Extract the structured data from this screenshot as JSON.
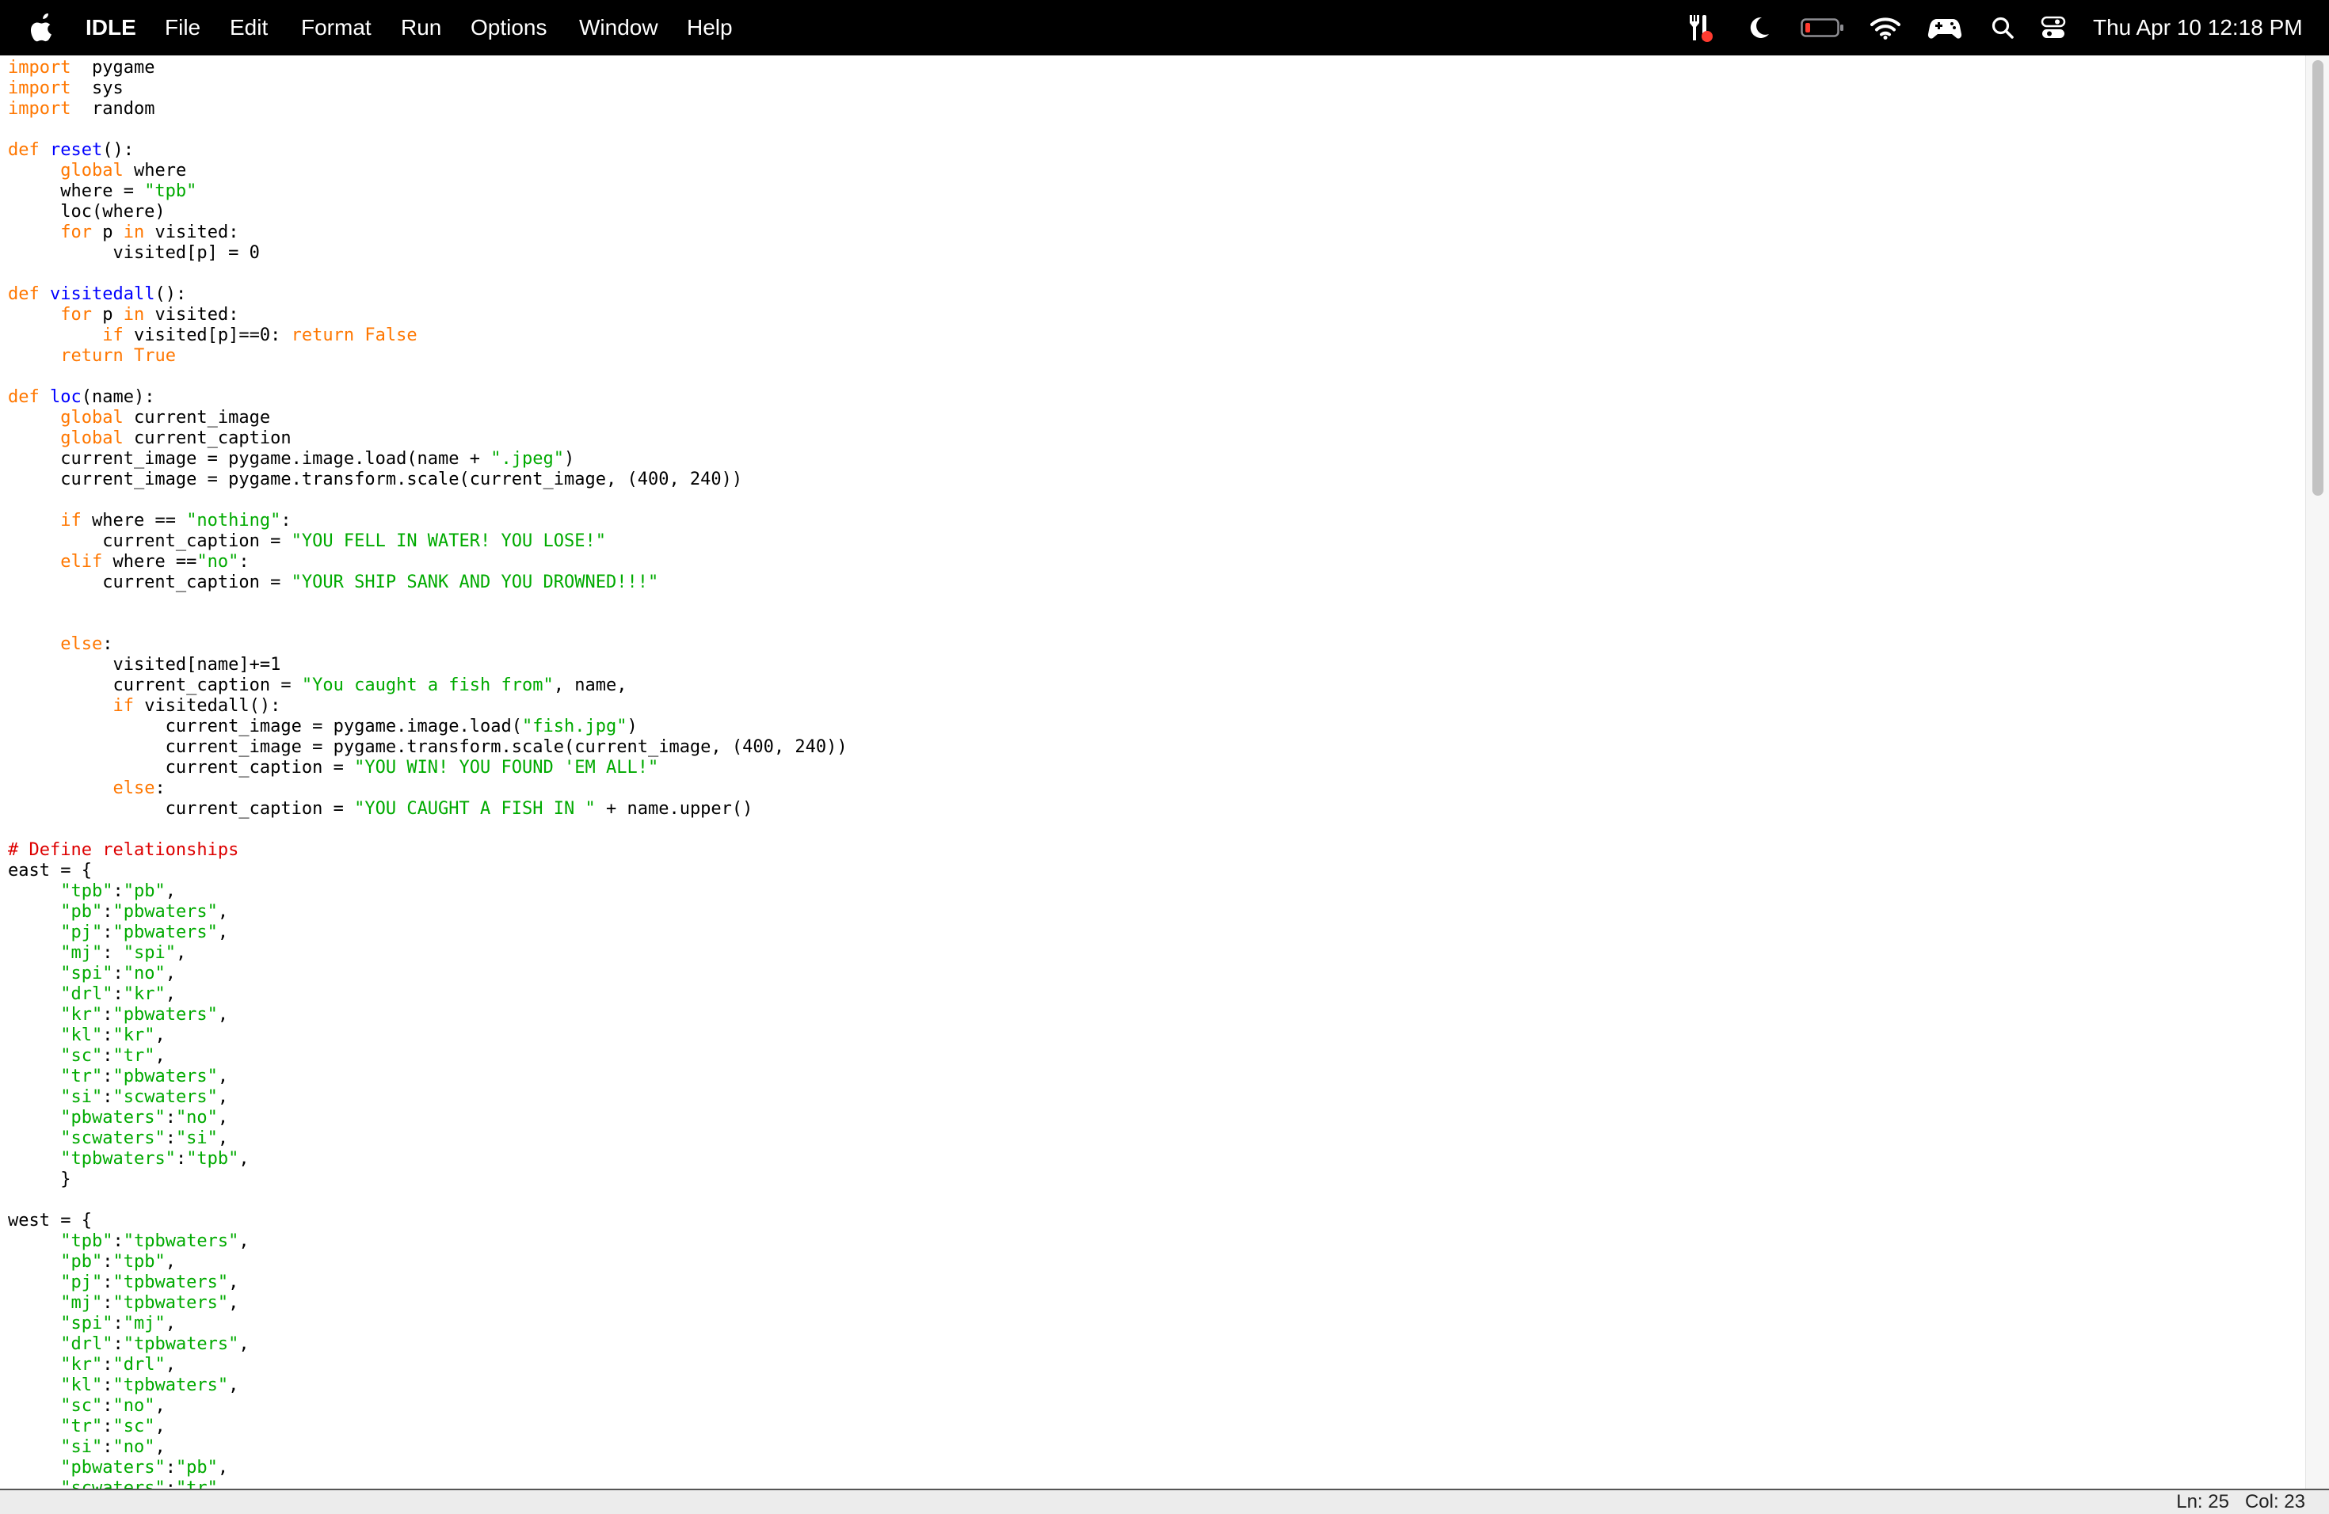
{
  "menubar": {
    "app_name": "IDLE",
    "items": [
      "File",
      "Edit",
      "Format",
      "Run",
      "Options",
      "Window",
      "Help"
    ],
    "status_icons": [
      "apple-icon",
      "app-status-icon",
      "focus-moon-icon",
      "battery-icon",
      "wifi-icon",
      "game-controller-icon",
      "search-icon",
      "control-center-icon"
    ],
    "datetime": "Thu Apr 10  12:18 PM"
  },
  "colors": {
    "keyword": "#ff7700",
    "builtin": "#900090",
    "definition": "#0000ff",
    "string": "#00aa00",
    "comment": "#dd0000",
    "battery_low": "#ff3b30"
  },
  "editor": {
    "lines": [
      [
        [
          "kw",
          "import"
        ],
        [
          "",
          "  pygame"
        ]
      ],
      [
        [
          "kw",
          "import"
        ],
        [
          "",
          "  sys"
        ]
      ],
      [
        [
          "kw",
          "import"
        ],
        [
          "",
          "  random"
        ]
      ],
      [],
      [
        [
          "kw",
          "def"
        ],
        [
          "",
          " "
        ],
        [
          "fn",
          "reset"
        ],
        [
          "",
          "():"
        ]
      ],
      [
        [
          "",
          "     "
        ],
        [
          "kw",
          "global"
        ],
        [
          "",
          " where"
        ]
      ],
      [
        [
          "",
          "     where = "
        ],
        [
          "str",
          "\"tpb\""
        ]
      ],
      [
        [
          "",
          "     loc(where)"
        ]
      ],
      [
        [
          "",
          "     "
        ],
        [
          "kw",
          "for"
        ],
        [
          "",
          " p "
        ],
        [
          "kw",
          "in"
        ],
        [
          "",
          " visited:"
        ]
      ],
      [
        [
          "",
          "          visited[p] = 0"
        ]
      ],
      [],
      [
        [
          "kw",
          "def"
        ],
        [
          "",
          " "
        ],
        [
          "fn",
          "visitedall"
        ],
        [
          "",
          "():"
        ]
      ],
      [
        [
          "",
          "     "
        ],
        [
          "kw",
          "for"
        ],
        [
          "",
          " p "
        ],
        [
          "kw",
          "in"
        ],
        [
          "",
          " visited:"
        ]
      ],
      [
        [
          "",
          "         "
        ],
        [
          "kw",
          "if"
        ],
        [
          "",
          " visited[p]==0: "
        ],
        [
          "kw",
          "return"
        ],
        [
          "",
          " "
        ],
        [
          "kw",
          "False"
        ]
      ],
      [
        [
          "",
          "     "
        ],
        [
          "kw",
          "return"
        ],
        [
          "",
          " "
        ],
        [
          "kw",
          "True"
        ]
      ],
      [],
      [
        [
          "kw",
          "def"
        ],
        [
          "",
          " "
        ],
        [
          "fn",
          "loc"
        ],
        [
          "",
          "(name):"
        ]
      ],
      [
        [
          "",
          "     "
        ],
        [
          "kw",
          "global"
        ],
        [
          "",
          " current_image"
        ]
      ],
      [
        [
          "",
          "     "
        ],
        [
          "kw",
          "global"
        ],
        [
          "",
          " current_caption"
        ]
      ],
      [
        [
          "",
          "     current_image = pygame.image.load(name + "
        ],
        [
          "str",
          "\".jpeg\""
        ],
        [
          "",
          ")"
        ]
      ],
      [
        [
          "",
          "     current_image = pygame.transform.scale(current_image, (400, 240))"
        ]
      ],
      [],
      [
        [
          "",
          "     "
        ],
        [
          "kw",
          "if"
        ],
        [
          "",
          " where == "
        ],
        [
          "str",
          "\"nothing\""
        ],
        [
          "",
          ":"
        ]
      ],
      [
        [
          "",
          "         current_caption = "
        ],
        [
          "str",
          "\"YOU FELL IN WATER! YOU LOSE!\""
        ]
      ],
      [
        [
          "",
          "     "
        ],
        [
          "kw",
          "elif"
        ],
        [
          "",
          " where =="
        ],
        [
          "str",
          "\"no\""
        ],
        [
          "",
          ":"
        ]
      ],
      [
        [
          "",
          "         current_caption = "
        ],
        [
          "str",
          "\"YOUR SHIP SANK AND YOU DROWNED!!!\""
        ]
      ],
      [],
      [],
      [
        [
          "",
          "     "
        ],
        [
          "kw",
          "else"
        ],
        [
          "",
          ":"
        ]
      ],
      [
        [
          "",
          "          visited[name]+=1"
        ]
      ],
      [
        [
          "",
          "          current_caption = "
        ],
        [
          "str",
          "\"You caught a fish from\""
        ],
        [
          "",
          ", name,"
        ]
      ],
      [
        [
          "",
          "          "
        ],
        [
          "kw",
          "if"
        ],
        [
          "",
          " visitedall():"
        ]
      ],
      [
        [
          "",
          "               current_image = pygame.image.load("
        ],
        [
          "str",
          "\"fish.jpg\""
        ],
        [
          "",
          ")"
        ]
      ],
      [
        [
          "",
          "               current_image = pygame.transform.scale(current_image, (400, 240))"
        ]
      ],
      [
        [
          "",
          "               current_caption = "
        ],
        [
          "str",
          "\"YOU WIN! YOU FOUND 'EM ALL!\""
        ]
      ],
      [
        [
          "",
          "          "
        ],
        [
          "kw",
          "else"
        ],
        [
          "",
          ":"
        ]
      ],
      [
        [
          "",
          "               current_caption = "
        ],
        [
          "str",
          "\"YOU CAUGHT A FISH IN \""
        ],
        [
          "",
          " + name.upper()"
        ]
      ],
      [],
      [
        [
          "cm",
          "# Define relationships"
        ]
      ],
      [
        [
          "",
          "east = {"
        ]
      ],
      [
        [
          "",
          "     "
        ],
        [
          "str",
          "\"tpb\""
        ],
        [
          "",
          ":"
        ],
        [
          "str",
          "\"pb\""
        ],
        [
          "",
          ","
        ]
      ],
      [
        [
          "",
          "     "
        ],
        [
          "str",
          "\"pb\""
        ],
        [
          "",
          ":"
        ],
        [
          "str",
          "\"pbwaters\""
        ],
        [
          "",
          ","
        ]
      ],
      [
        [
          "",
          "     "
        ],
        [
          "str",
          "\"pj\""
        ],
        [
          "",
          ":"
        ],
        [
          "str",
          "\"pbwaters\""
        ],
        [
          "",
          ","
        ]
      ],
      [
        [
          "",
          "     "
        ],
        [
          "str",
          "\"mj\""
        ],
        [
          "",
          ": "
        ],
        [
          "str",
          "\"spi\""
        ],
        [
          "",
          ","
        ]
      ],
      [
        [
          "",
          "     "
        ],
        [
          "str",
          "\"spi\""
        ],
        [
          "",
          ":"
        ],
        [
          "str",
          "\"no\""
        ],
        [
          "",
          ","
        ]
      ],
      [
        [
          "",
          "     "
        ],
        [
          "str",
          "\"drl\""
        ],
        [
          "",
          ":"
        ],
        [
          "str",
          "\"kr\""
        ],
        [
          "",
          ","
        ]
      ],
      [
        [
          "",
          "     "
        ],
        [
          "str",
          "\"kr\""
        ],
        [
          "",
          ":"
        ],
        [
          "str",
          "\"pbwaters\""
        ],
        [
          "",
          ","
        ]
      ],
      [
        [
          "",
          "     "
        ],
        [
          "str",
          "\"kl\""
        ],
        [
          "",
          ":"
        ],
        [
          "str",
          "\"kr\""
        ],
        [
          "",
          ","
        ]
      ],
      [
        [
          "",
          "     "
        ],
        [
          "str",
          "\"sc\""
        ],
        [
          "",
          ":"
        ],
        [
          "str",
          "\"tr\""
        ],
        [
          "",
          ","
        ]
      ],
      [
        [
          "",
          "     "
        ],
        [
          "str",
          "\"tr\""
        ],
        [
          "",
          ":"
        ],
        [
          "str",
          "\"pbwaters\""
        ],
        [
          "",
          ","
        ]
      ],
      [
        [
          "",
          "     "
        ],
        [
          "str",
          "\"si\""
        ],
        [
          "",
          ":"
        ],
        [
          "str",
          "\"scwaters\""
        ],
        [
          "",
          ","
        ]
      ],
      [
        [
          "",
          "     "
        ],
        [
          "str",
          "\"pbwaters\""
        ],
        [
          "",
          ":"
        ],
        [
          "str",
          "\"no\""
        ],
        [
          "",
          ","
        ]
      ],
      [
        [
          "",
          "     "
        ],
        [
          "str",
          "\"scwaters\""
        ],
        [
          "",
          ":"
        ],
        [
          "str",
          "\"si\""
        ],
        [
          "",
          ","
        ]
      ],
      [
        [
          "",
          "     "
        ],
        [
          "str",
          "\"tpbwaters\""
        ],
        [
          "",
          ":"
        ],
        [
          "str",
          "\"tpb\""
        ],
        [
          "",
          ","
        ]
      ],
      [
        [
          "",
          "     }"
        ]
      ],
      [],
      [
        [
          "",
          "west = {"
        ]
      ],
      [
        [
          "",
          "     "
        ],
        [
          "str",
          "\"tpb\""
        ],
        [
          "",
          ":"
        ],
        [
          "str",
          "\"tpbwaters\""
        ],
        [
          "",
          ","
        ]
      ],
      [
        [
          "",
          "     "
        ],
        [
          "str",
          "\"pb\""
        ],
        [
          "",
          ":"
        ],
        [
          "str",
          "\"tpb\""
        ],
        [
          "",
          ","
        ]
      ],
      [
        [
          "",
          "     "
        ],
        [
          "str",
          "\"pj\""
        ],
        [
          "",
          ":"
        ],
        [
          "str",
          "\"tpbwaters\""
        ],
        [
          "",
          ","
        ]
      ],
      [
        [
          "",
          "     "
        ],
        [
          "str",
          "\"mj\""
        ],
        [
          "",
          ":"
        ],
        [
          "str",
          "\"tpbwaters\""
        ],
        [
          "",
          ","
        ]
      ],
      [
        [
          "",
          "     "
        ],
        [
          "str",
          "\"spi\""
        ],
        [
          "",
          ":"
        ],
        [
          "str",
          "\"mj\""
        ],
        [
          "",
          ","
        ]
      ],
      [
        [
          "",
          "     "
        ],
        [
          "str",
          "\"drl\""
        ],
        [
          "",
          ":"
        ],
        [
          "str",
          "\"tpbwaters\""
        ],
        [
          "",
          ","
        ]
      ],
      [
        [
          "",
          "     "
        ],
        [
          "str",
          "\"kr\""
        ],
        [
          "",
          ":"
        ],
        [
          "str",
          "\"drl\""
        ],
        [
          "",
          ","
        ]
      ],
      [
        [
          "",
          "     "
        ],
        [
          "str",
          "\"kl\""
        ],
        [
          "",
          ":"
        ],
        [
          "str",
          "\"tpbwaters\""
        ],
        [
          "",
          ","
        ]
      ],
      [
        [
          "",
          "     "
        ],
        [
          "str",
          "\"sc\""
        ],
        [
          "",
          ":"
        ],
        [
          "str",
          "\"no\""
        ],
        [
          "",
          ","
        ]
      ],
      [
        [
          "",
          "     "
        ],
        [
          "str",
          "\"tr\""
        ],
        [
          "",
          ":"
        ],
        [
          "str",
          "\"sc\""
        ],
        [
          "",
          ","
        ]
      ],
      [
        [
          "",
          "     "
        ],
        [
          "str",
          "\"si\""
        ],
        [
          "",
          ":"
        ],
        [
          "str",
          "\"no\""
        ],
        [
          "",
          ","
        ]
      ],
      [
        [
          "",
          "     "
        ],
        [
          "str",
          "\"pbwaters\""
        ],
        [
          "",
          ":"
        ],
        [
          "str",
          "\"pb\""
        ],
        [
          "",
          ","
        ]
      ],
      [
        [
          "",
          "     "
        ],
        [
          "str",
          "\"scwaters\""
        ],
        [
          "",
          ":"
        ],
        [
          "str",
          "\"tr\""
        ],
        [
          "",
          ","
        ]
      ]
    ]
  },
  "statusbar": {
    "position": "Ln: 25   Col: 23"
  }
}
